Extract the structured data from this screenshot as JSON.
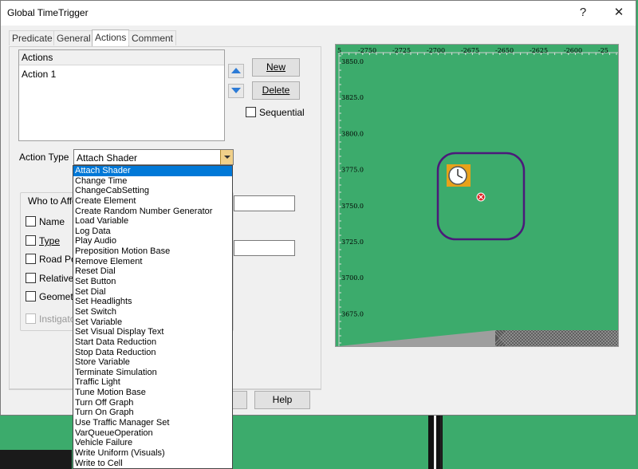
{
  "window": {
    "title": "Global TimeTrigger",
    "help_glyph": "?",
    "close_glyph": "✕"
  },
  "tabs": [
    {
      "label": "Predicate"
    },
    {
      "label": "General"
    },
    {
      "label": "Actions"
    },
    {
      "label": "Comment"
    }
  ],
  "actions": {
    "header": "Actions",
    "items": [
      "Action 1"
    ],
    "new_label": "New",
    "delete_label": "Delete",
    "sequential_label": "Sequential"
  },
  "action_type": {
    "label": "Action Type",
    "value": "Attach Shader",
    "options": [
      "Attach Shader",
      "Change Time",
      "ChangeCabSetting",
      "Create Element",
      "Create Random Number Generator",
      "Load Variable",
      "Log Data",
      "Play Audio",
      "Preposition Motion Base",
      "Remove Element",
      "Reset Dial",
      "Set Button",
      "Set Dial",
      "Set Headlights",
      "Set Switch",
      "Set Variable",
      "Set Visual Display Text",
      "Start Data Reduction",
      "Stop Data Reduction",
      "Store Variable",
      "Terminate Simulation",
      "Traffic Light",
      "Tune Motion Base",
      "Turn Off Graph",
      "Turn On Graph",
      "Use Traffic Manager Set",
      "VarQueueOperation",
      "Vehicle Failure",
      "Write Uniform (Visuals)",
      "Write to Cell"
    ]
  },
  "who_to_affect": {
    "legend": "Who to Affec",
    "options": [
      "Name",
      "Type",
      "Road Pos",
      "Relative",
      "Geometric"
    ],
    "instigator": "Instigator"
  },
  "footer": {
    "help_label": "Help"
  },
  "map": {
    "x_ticks": [
      "-2750",
      "-2725",
      "-2700",
      "-2675",
      "-2650",
      "-2625",
      "-2600",
      "-25"
    ],
    "y_ticks": [
      "3850.0",
      "3825.0",
      "3800.0",
      "3775.0",
      "3750.0",
      "3725.0",
      "3700.0",
      "3675.0"
    ],
    "x_tick_left_partial": "5",
    "bg_color": "#3cab6c",
    "region_color": "#4b1a7a",
    "clock_icon": "clock-icon",
    "marker_icon": "trigger-marker-icon"
  }
}
